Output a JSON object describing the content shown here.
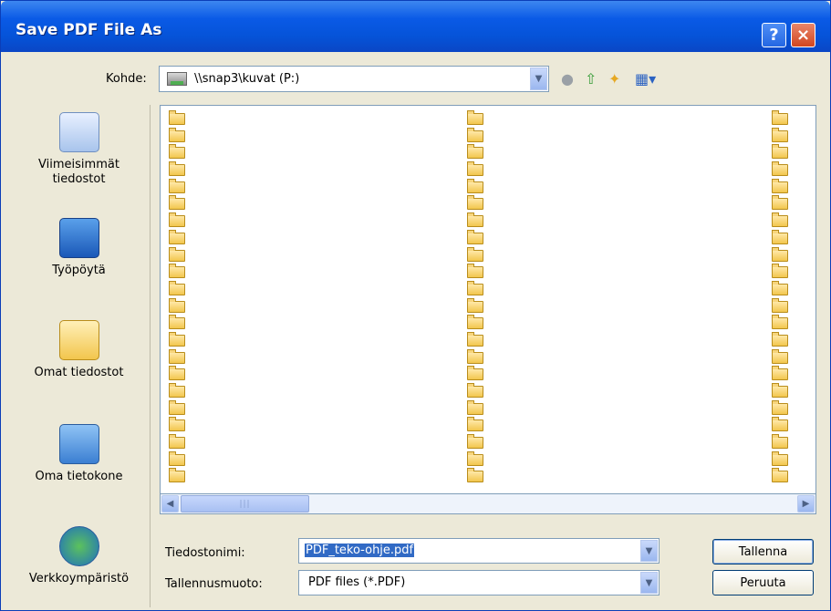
{
  "window": {
    "title": "Save PDF File As",
    "help_label": "?",
    "close_label": "×"
  },
  "location": {
    "label": "Kohde:",
    "value": "\\\\snap3\\kuvat (P:)"
  },
  "toolbar": {
    "back_icon": "back-icon",
    "up_icon": "up-folder-icon",
    "new_folder_icon": "new-folder-icon",
    "views_icon": "views-menu-icon"
  },
  "places": [
    {
      "label": "Viimeisimmät\ntiedostot",
      "icon": "recent-documents-icon"
    },
    {
      "label": "Työpöytä",
      "icon": "desktop-icon"
    },
    {
      "label": "Omat tiedostot",
      "icon": "my-documents-icon"
    },
    {
      "label": "Oma tietokone",
      "icon": "my-computer-icon"
    },
    {
      "label": "Verkkoympäristö",
      "icon": "network-places-icon"
    }
  ],
  "scrollbar": {
    "left_label": "◀",
    "right_label": "▶",
    "thumb_label": "|||"
  },
  "filename": {
    "label": "Tiedostonimi:",
    "value": "PDF_teko-ohje.pdf"
  },
  "filetype": {
    "label": "Tallennusmuoto:",
    "value": "PDF files (*.PDF)"
  },
  "buttons": {
    "save": "Tallenna",
    "cancel": "Peruuta"
  },
  "colors": {
    "titlebar": "#0553d8",
    "selection": "#316ac5"
  }
}
